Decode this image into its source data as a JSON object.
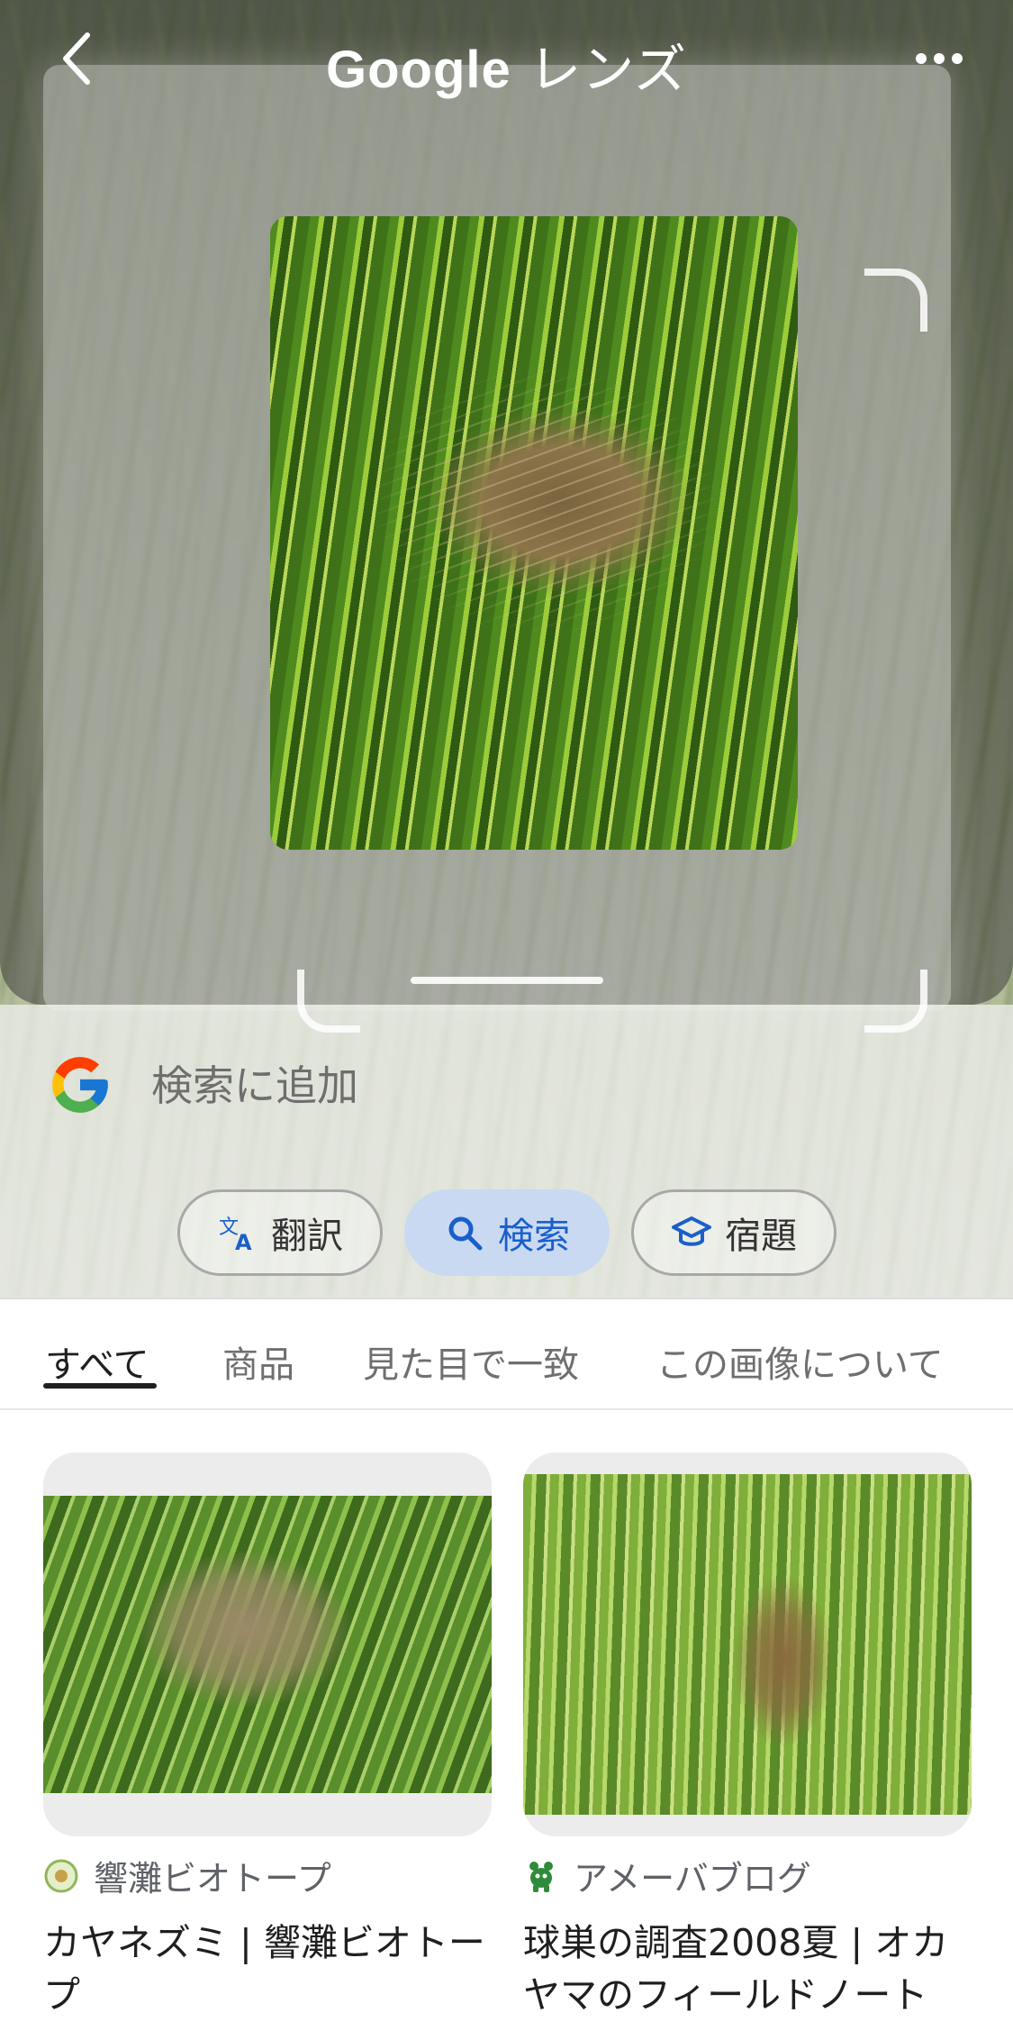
{
  "header": {
    "title_brand": "Google",
    "title_suffix": "レンズ",
    "back_icon": "chevron-left-icon",
    "more_icon": "more-horizontal-icon"
  },
  "search": {
    "placeholder": "検索に追加",
    "logo": "google-g-icon"
  },
  "chips": [
    {
      "label": "翻訳",
      "icon": "translate-icon"
    },
    {
      "label": "検索",
      "icon": "search-icon"
    },
    {
      "label": "宿題",
      "icon": "school-icon"
    }
  ],
  "tabs": [
    {
      "label": "すべて"
    },
    {
      "label": "商品"
    },
    {
      "label": "見た目で一致"
    },
    {
      "label": "この画像について"
    }
  ],
  "results": [
    {
      "source": "響灘ビオトープ",
      "title": "カヤネズミ | 響灘ビオトープ"
    },
    {
      "source": "アメーバブログ",
      "title": "球巣の調査2008夏 | オカヤマのフィールドノート"
    }
  ],
  "colors": {
    "accent": "#1a5fc9",
    "active_chip_bg": "#c9d9f2"
  }
}
